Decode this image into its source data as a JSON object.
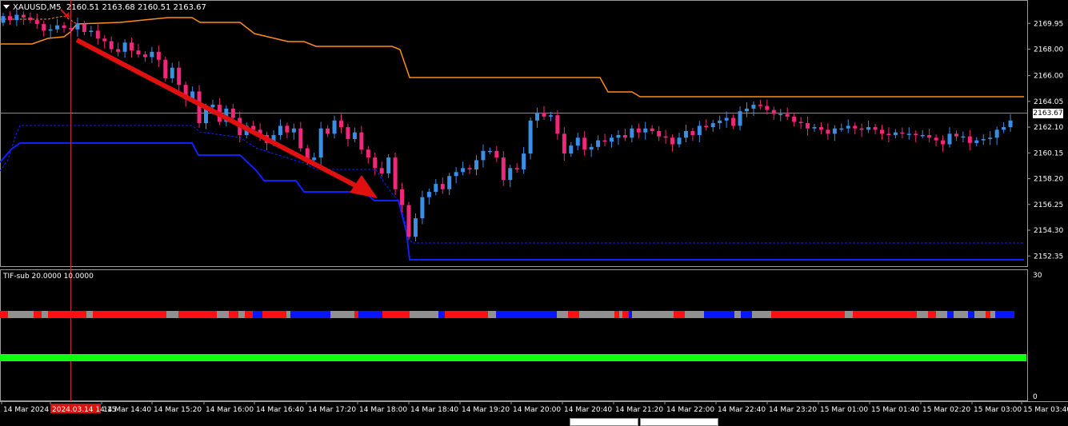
{
  "symbol": {
    "name": "XAUUSD,M5",
    "ohlc": "2160.51 2163.68 2160.51 2163.67"
  },
  "current_price": "2163.67",
  "subwindow": {
    "title": "TIF-sub 20.0000 10.0000"
  },
  "colors": {
    "bull": "#3a8ee6",
    "bear": "#f0287a",
    "upper_band": "#ff8c1a",
    "lower_band": "#1020ff",
    "arrow": "#e01010",
    "strip_red": "#ff1010",
    "strip_grey": "#909090",
    "strip_blue": "#0a14ff",
    "green_line": "#10ff10"
  },
  "chart_data": {
    "type": "candlestick",
    "price_axis_ticks": [
      "2169.95",
      "2168.00",
      "2166.00",
      "2164.05",
      "2162.10",
      "2160.15",
      "2158.20",
      "2156.25",
      "2154.30",
      "2152.35"
    ],
    "price_range": [
      2151.7,
      2171.6
    ],
    "sub_axis_ticks": [
      "30",
      "0"
    ],
    "time_labels": [
      "14 Mar 2024",
      "2024.03.14 14:15",
      "14 Mar 14:40",
      "14 Mar 15:20",
      "14 Mar 16:00",
      "14 Mar 16:40",
      "14 Mar 17:20",
      "14 Mar 18:00",
      "14 Mar 18:40",
      "14 Mar 19:20",
      "14 Mar 20:00",
      "14 Mar 20:40",
      "14 Mar 21:20",
      "14 Mar 22:00",
      "14 Mar 22:40",
      "14 Mar 23:20",
      "15 Mar 01:00",
      "15 Mar 01:40",
      "15 Mar 02:20",
      "15 Mar 03:00",
      "15 Mar 03:40"
    ],
    "closes": [
      2170.5,
      2170.2,
      2170.6,
      2170.4,
      2170.2,
      2169.9,
      2169.4,
      2169.5,
      2169.8,
      2169.6,
      2169.5,
      2169.9,
      2169.3,
      2169.4,
      2168.8,
      2168.6,
      2168.0,
      2167.8,
      2168.5,
      2167.9,
      2167.6,
      2167.4,
      2167.8,
      2167.2,
      2165.8,
      2166.6,
      2165.3,
      2164.2,
      2164.8,
      2162.4,
      2163.6,
      2163.8,
      2162.5,
      2163.5,
      2162.8,
      2161.5,
      2162.2,
      2161.9,
      2161.5,
      2160.9,
      2161.5,
      2162.2,
      2161.7,
      2162.0,
      2160.5,
      2159.6,
      2159.8,
      2162.0,
      2161.6,
      2162.6,
      2162.1,
      2161.2,
      2161.7,
      2160.4,
      2159.8,
      2159.0,
      2158.6,
      2159.8,
      2157.4,
      2156.2,
      2153.8,
      2155.2,
      2156.8,
      2157.2,
      2157.8,
      2157.4,
      2158.4,
      2158.7,
      2159.0,
      2158.9,
      2159.6,
      2160.3,
      2160.3,
      2159.8,
      2158.1,
      2159.0,
      2158.9,
      2160.1,
      2162.6,
      2163.2,
      2162.9,
      2163.0,
      2161.6,
      2160.1,
      2160.7,
      2161.3,
      2160.4,
      2160.6,
      2161.1,
      2161.0,
      2161.3,
      2161.5,
      2161.3,
      2162.0,
      2161.7,
      2162.0,
      2161.8,
      2161.4,
      2161.3,
      2160.8,
      2161.3,
      2161.8,
      2161.5,
      2162.2,
      2162.1,
      2162.4,
      2162.6,
      2162.8,
      2162.2,
      2163.3,
      2163.5,
      2163.8,
      2163.7,
      2163.4,
      2163.1,
      2163.1,
      2162.9,
      2162.5,
      2162.4,
      2162.0,
      2162.1,
      2161.9,
      2161.6,
      2162.0,
      2162.0,
      2162.2,
      2162.0,
      2161.9,
      2162.1,
      2161.9,
      2161.6,
      2161.5,
      2161.7,
      2161.6,
      2161.6,
      2161.5,
      2161.5,
      2161.3,
      2161.1,
      2160.8,
      2161.6,
      2161.4,
      2161.4,
      2160.9,
      2161.1,
      2161.2,
      2161.3,
      2161.9,
      2162.1,
      2162.6
    ]
  }
}
